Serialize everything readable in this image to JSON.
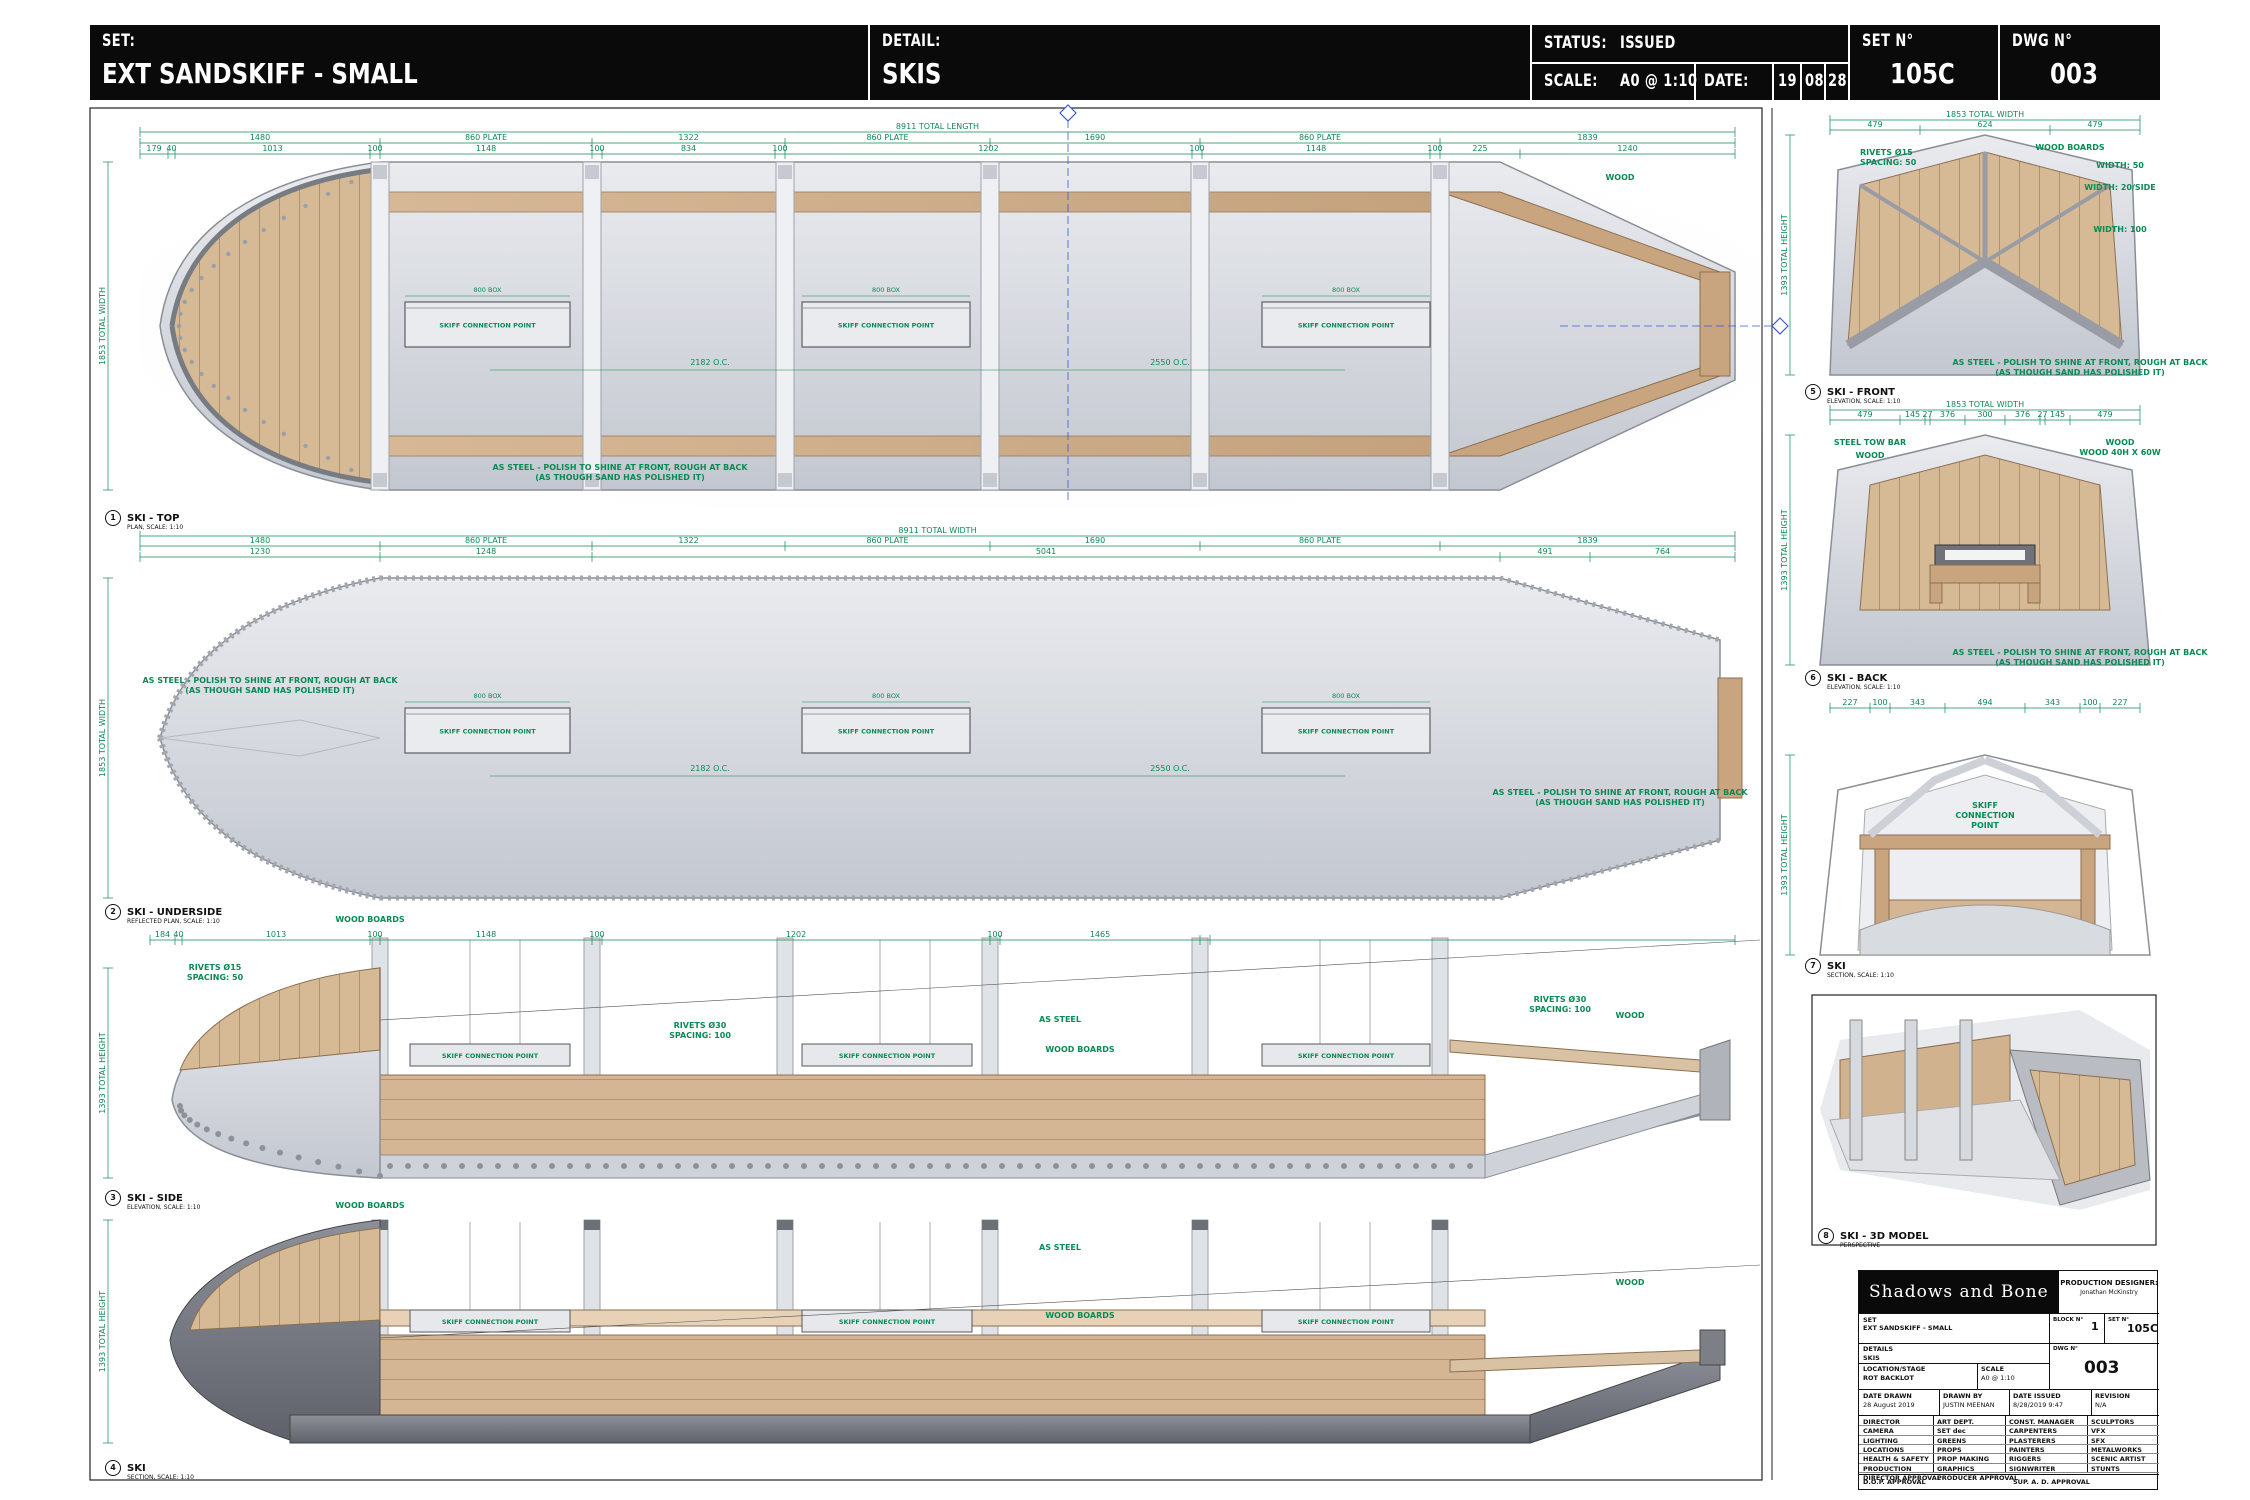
{
  "header": {
    "set_label": "SET:",
    "set_value": "EXT SANDSKIFF - SMALL",
    "detail_label": "DETAIL:",
    "detail_value": "SKIS",
    "status_label": "STATUS:",
    "status_value": "ISSUED",
    "scale_label": "SCALE:",
    "scale_value": "A0 @ 1:10",
    "date_label": "DATE:",
    "date_d": "19",
    "date_m": "08",
    "date_y": "28",
    "set_no_label": "SET N°",
    "set_no_value": "105C",
    "dwg_no_label": "DWG N°",
    "dwg_no_value": "003"
  },
  "views": {
    "top": {
      "num": "1",
      "title": "SKI - TOP",
      "sub": "PLAN, SCALE: 1:10"
    },
    "underside": {
      "num": "2",
      "title": "SKI - UNDERSIDE",
      "sub": "REFLECTED PLAN, SCALE: 1:10"
    },
    "side": {
      "num": "3",
      "title": "SKI - SIDE",
      "sub": "ELEVATION, SCALE: 1:10"
    },
    "section": {
      "num": "4",
      "title": "SKI",
      "sub": "SECTION, SCALE: 1:10"
    },
    "front": {
      "num": "5",
      "title": "SKI - FRONT",
      "sub": "ELEVATION, SCALE: 1:10"
    },
    "back": {
      "num": "6",
      "title": "SKI - BACK",
      "sub": "ELEVATION, SCALE: 1:10"
    },
    "xsection": {
      "num": "7",
      "title": "SKI",
      "sub": "SECTION, SCALE: 1:10"
    },
    "model": {
      "num": "8",
      "title": "SKI - 3D MODEL",
      "sub": "PERSPECTIVE"
    }
  },
  "dims": {
    "top_total": "8911 TOTAL LENGTH",
    "under_total": "8911 TOTAL WIDTH",
    "top_row1": [
      "1480",
      "860 PLATE",
      "1322",
      "860 PLATE",
      "1690",
      "860 PLATE",
      "1839"
    ],
    "top_row2": [
      "179",
      "40",
      "1013",
      "100",
      "1148",
      "100",
      "834",
      "100",
      "1202",
      "100",
      "1148",
      "100",
      "225",
      "1240"
    ],
    "under_row1": [
      "1480",
      "860 PLATE",
      "1322",
      "860 PLATE",
      "1690",
      "860 PLATE",
      "1839"
    ],
    "under_row2": [
      "1230",
      "1248",
      "5041",
      "491",
      "764"
    ],
    "side_row": [
      "184",
      "40",
      "1013",
      "100",
      "1148",
      "100",
      "1202",
      "100",
      "1465"
    ],
    "oc1": "2182 O.C.",
    "oc2": "2550 O.C.",
    "box": "800 BOX",
    "total_width": "1853 TOTAL WIDTH",
    "total_height": "1393 TOTAL HEIGHT",
    "front_total": "1853 TOTAL WIDTH",
    "front_row": [
      "479",
      "624",
      "479"
    ],
    "back_row": [
      "479",
      "145",
      "27",
      "376",
      "300",
      "376",
      "27",
      "145",
      "479"
    ],
    "xs_row": [
      "227",
      "100",
      "343",
      "494",
      "343",
      "100",
      "227"
    ]
  },
  "notes": {
    "connection": "SKIFF CONNECTION POINT",
    "wood": "WOOD",
    "wood_boards": "WOOD BOARDS",
    "as_steel": "AS STEEL",
    "steel_note_1": "AS STEEL - POLISH TO SHINE AT FRONT, ROUGH AT BACK",
    "steel_note_2": "(AS THOUGH SAND HAS POLISHED IT)",
    "rivets15": "RIVETS Ø15",
    "rivets15_sp": "SPACING: 50",
    "rivets30": "RIVETS Ø30",
    "rivets30_sp": "SPACING: 100",
    "width50": "WIDTH: 50",
    "width20": "WIDTH: 20/SIDE",
    "width100": "WIDTH: 100",
    "steel_tow": "STEEL TOW BAR",
    "wood40": "WOOD 40H X 60W",
    "skiff_cp": "SKIFF CONNECTION POINT"
  },
  "title_block": {
    "studio": "Shadows and Bone",
    "pd_label": "PRODUCTION DESIGNER:",
    "pd_name": "Jonathan McKinstry",
    "set_label": "SET",
    "set_value": "EXT SANDSKIFF - SMALL",
    "location": "ROT BACKLOT",
    "block_label": "BLOCK N°",
    "block_value": "1",
    "set_no_label": "SET N°",
    "set_no_value": "105C",
    "details_label": "DETAILS",
    "details_value": "SKIS",
    "dwg_label": "DWG N°",
    "dwg_value": "003",
    "loc_label": "LOCATION/STAGE",
    "scale_label": "SCALE",
    "scale_value": "A0 @ 1:10",
    "date_drawn_label": "DATE DRAWN",
    "date_drawn": "28 August 2019",
    "drawn_by_label": "DRAWN BY",
    "drawn_by": "JUSTIN MEENAN",
    "date_issued_label": "DATE ISSUED",
    "date_issued": "8/28/2019 9:47",
    "revision_label": "REVISION",
    "revision": "N/A",
    "dept_col1": [
      "DIRECTOR",
      "CAMERA",
      "LIGHTING",
      "LOCATIONS",
      "HEALTH & SAFETY",
      "PRODUCTION",
      "DIRECTOR APPROVAL"
    ],
    "dept_col2": [
      "ART DEPT.",
      "SET dec",
      "GREENS",
      "PROPS",
      "PROP MAKING",
      "GRAPHICS",
      "PRODUCER APPROVAL"
    ],
    "dept_col3": [
      "CONST. MANAGER",
      "CARPENTERS",
      "PLASTERERS",
      "PAINTERS",
      "RIGGERS",
      "SIGNWRITER"
    ],
    "dept_col4": [
      "SCULPTORS",
      "VFX",
      "SFX",
      "METALWORKS",
      "SCENIC ARTIST",
      "STUNTS"
    ],
    "dop": "D.O.P. APPROVAL",
    "supad": "SUP. A. D. APPROVAL"
  }
}
